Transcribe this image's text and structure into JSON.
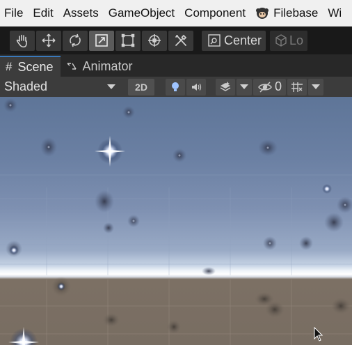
{
  "menubar": {
    "items": [
      "File",
      "Edit",
      "Assets",
      "GameObject",
      "Component",
      "Filebase",
      "Wi"
    ]
  },
  "toolbar": {
    "tools": [
      {
        "name": "hand-tool",
        "icon": "hand-icon",
        "active": false
      },
      {
        "name": "move-tool",
        "icon": "move-icon",
        "active": false
      },
      {
        "name": "rotate-tool",
        "icon": "rotate-icon",
        "active": false
      },
      {
        "name": "scale-tool",
        "icon": "scale-icon",
        "active": true
      },
      {
        "name": "rect-tool",
        "icon": "rect-icon",
        "active": false
      },
      {
        "name": "transform-tool",
        "icon": "transform-icon",
        "active": false
      },
      {
        "name": "custom-tool",
        "icon": "tools-icon",
        "active": false
      }
    ],
    "pivot_label": "Center",
    "local_label": "Lo"
  },
  "tabs": [
    {
      "label": "Scene",
      "icon": "#",
      "active": true
    },
    {
      "label": "Animator",
      "icon": "animator-icon",
      "active": false
    }
  ],
  "scenebar": {
    "shading_mode": "Shaded",
    "mode_2d": "2D",
    "hidden_count": "0"
  },
  "colors": {
    "accent": "#3a79bb",
    "sky_top": "#5e7598",
    "ground": "#786d62"
  }
}
